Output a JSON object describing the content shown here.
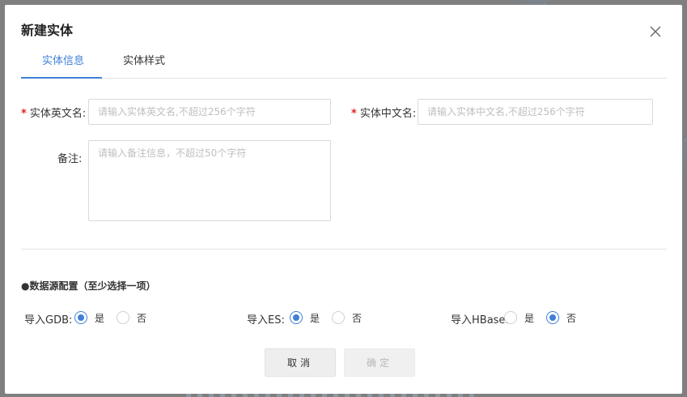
{
  "dialog": {
    "title": "新建实体",
    "close_icon": "close-icon"
  },
  "tabs": [
    {
      "label": "实体信息",
      "active": true
    },
    {
      "label": "实体样式",
      "active": false
    }
  ],
  "form": {
    "english_name": {
      "required_mark": "*",
      "label": "实体英文名:",
      "value": "",
      "placeholder": "请输入实体英文名,不超过256个字符"
    },
    "chinese_name": {
      "required_mark": "*",
      "label": "实体中文名:",
      "value": "",
      "placeholder": "请输入实体中文名,不超过256个字符"
    },
    "remark": {
      "label": "备注:",
      "value": "",
      "placeholder": "请输入备注信息，不超过50个字符"
    }
  },
  "datasource": {
    "title": "●数据源配置（至少选择一项）",
    "groups": [
      {
        "label": "导入GDB:",
        "options": [
          "是",
          "否"
        ],
        "selected": "是"
      },
      {
        "label": "导入ES:",
        "options": [
          "是",
          "否"
        ],
        "selected": "是"
      },
      {
        "label": "导入HBase:",
        "options": [
          "是",
          "否"
        ],
        "selected": "否"
      }
    ]
  },
  "buttons": {
    "cancel": "取消",
    "confirm": "确定",
    "confirm_disabled": true
  },
  "colors": {
    "accent": "#3f80d8",
    "required": "#e02020",
    "overlay": "#7f7f7f"
  }
}
